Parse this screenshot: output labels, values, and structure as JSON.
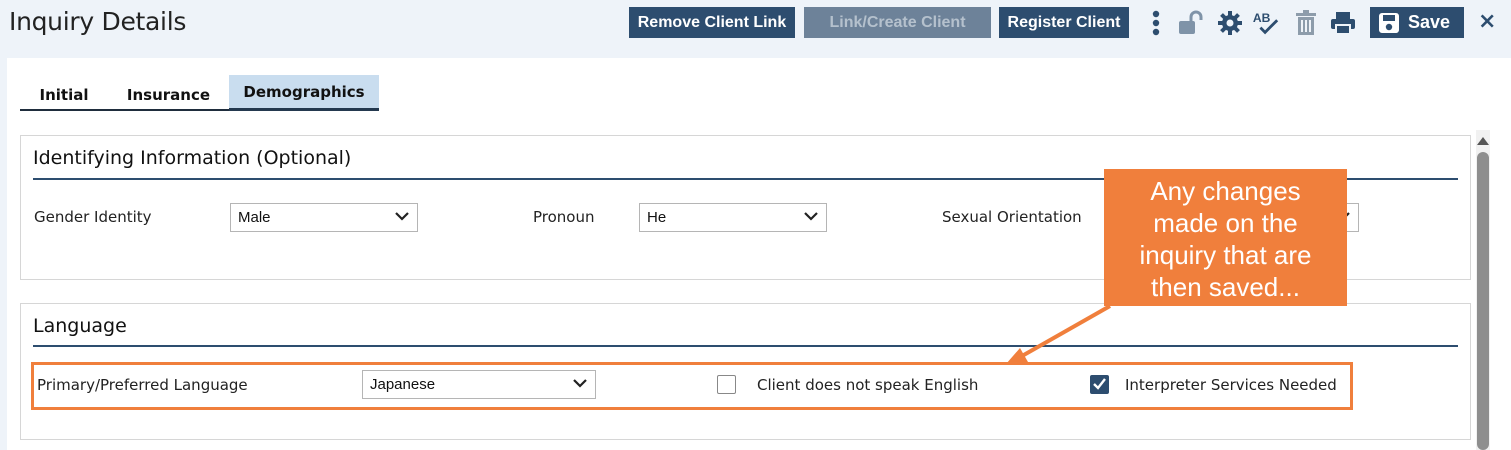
{
  "header": {
    "title": "Inquiry Details",
    "buttons": {
      "remove_client_link": "Remove Client Link",
      "link_create_client": "Link/Create Client",
      "register_client": "Register Client",
      "save": "Save"
    },
    "close": "×"
  },
  "tabs": [
    {
      "label": "Initial"
    },
    {
      "label": "Insurance"
    },
    {
      "label": "Demographics",
      "active": true
    }
  ],
  "identifying": {
    "title": "Identifying Information (Optional)",
    "gender_identity": {
      "label": "Gender Identity",
      "value": "Male"
    },
    "pronoun": {
      "label": "Pronoun",
      "value": "He"
    },
    "sexual_orientation": {
      "label": "Sexual Orientation",
      "value": ""
    }
  },
  "language": {
    "title": "Language",
    "primary": {
      "label": "Primary/Preferred Language",
      "value": "Japanese"
    },
    "no_english": {
      "label": "Client does not speak English",
      "checked": false
    },
    "interpreter": {
      "label": "Interpreter Services Needed",
      "checked": true
    }
  },
  "callout": {
    "lines": [
      "Any changes",
      "made on the",
      "inquiry that are",
      "then saved..."
    ]
  },
  "colors": {
    "primary": "#2d4d6f",
    "callout": "#f07f3c",
    "tab_active": "#c9ddef"
  }
}
